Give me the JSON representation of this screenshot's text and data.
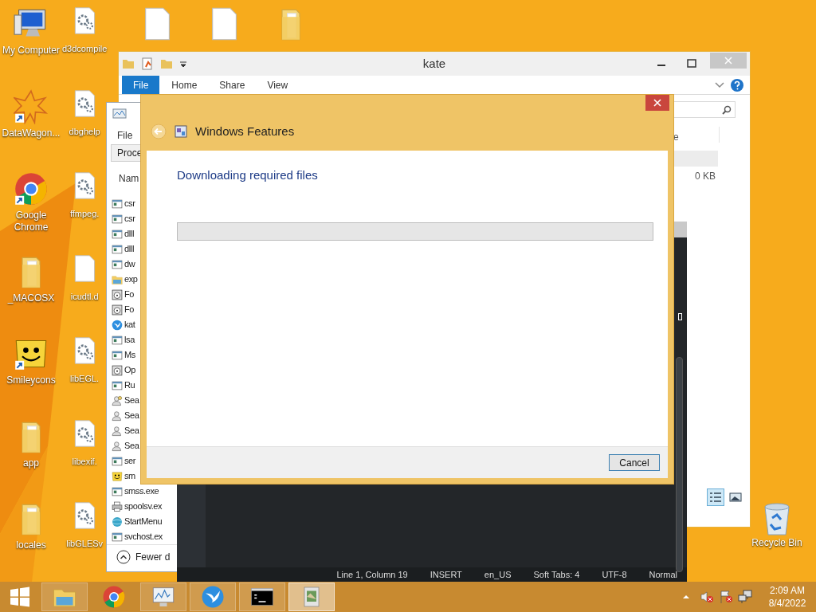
{
  "desktop_column_1": [
    {
      "label": "My Computer",
      "kind": "computer"
    },
    {
      "label": "DataWagon...",
      "kind": "star-shortcut"
    },
    {
      "label": "Google Chrome",
      "kind": "chrome-shortcut"
    },
    {
      "label": "_MACOSX",
      "kind": "folder"
    },
    {
      "label": "Smileycons",
      "kind": "smiley-shortcut"
    },
    {
      "label": "app",
      "kind": "folder"
    },
    {
      "label": "locales",
      "kind": "folder"
    }
  ],
  "desktop_column_2": [
    {
      "label": "d3dcompile",
      "kind": "gear-file"
    },
    {
      "label": "dbghelp",
      "kind": "gear-file"
    },
    {
      "label": "ffmpeg.",
      "kind": "gear-file"
    },
    {
      "label": "icudtl.d",
      "kind": "file"
    },
    {
      "label": "libEGL.",
      "kind": "gear-file"
    },
    {
      "label": "libexif.",
      "kind": "gear-file"
    },
    {
      "label": "libGLESv",
      "kind": "gear-file"
    }
  ],
  "explorer": {
    "title": "kate",
    "ribbon_tabs": [
      {
        "label": "File",
        "selected": true
      },
      {
        "label": "Home",
        "selected": false
      },
      {
        "label": "Share",
        "selected": false
      },
      {
        "label": "View",
        "selected": false
      }
    ],
    "column_header": "e",
    "size": "0 KB"
  },
  "task_manager": {
    "menu": "File",
    "tab": "Proce",
    "column": "Nam",
    "processes": [
      {
        "name": "csr",
        "kind": "exe"
      },
      {
        "name": "csr",
        "kind": "exe"
      },
      {
        "name": "dllI",
        "kind": "exe"
      },
      {
        "name": "dllI",
        "kind": "exe"
      },
      {
        "name": "dw",
        "kind": "exe"
      },
      {
        "name": "exp",
        "kind": "explorer"
      },
      {
        "name": "Fo",
        "kind": "disc"
      },
      {
        "name": "Fo",
        "kind": "disc"
      },
      {
        "name": "kat",
        "kind": "bird"
      },
      {
        "name": "lsa",
        "kind": "exe"
      },
      {
        "name": "Ms",
        "kind": "exe"
      },
      {
        "name": "Op",
        "kind": "disc"
      },
      {
        "name": "Ru",
        "kind": "exe"
      },
      {
        "name": "Sea",
        "kind": "user-search"
      },
      {
        "name": "Sea",
        "kind": "user"
      },
      {
        "name": "Sea",
        "kind": "user"
      },
      {
        "name": "Sea",
        "kind": "user"
      },
      {
        "name": "ser",
        "kind": "exe"
      },
      {
        "name": "sm",
        "kind": "smiley"
      },
      {
        "name": "smss.exe",
        "kind": "exe"
      },
      {
        "name": "spoolsv.ex",
        "kind": "printer"
      },
      {
        "name": "StartMenu",
        "kind": "globe"
      },
      {
        "name": "svchost.ex",
        "kind": "exe"
      }
    ],
    "footer": "Fewer d"
  },
  "kate": {
    "status_bar": [
      "Line 1, Column 19",
      "INSERT",
      "en_US",
      "Soft Tabs: 4",
      "UTF-8",
      "Normal"
    ]
  },
  "dialog": {
    "title": "Windows Features",
    "heading": "Downloading required files",
    "progress": {
      "level": 0
    },
    "buttons": [
      "Cancel"
    ]
  },
  "recycle_bin": "Recycle Bin",
  "taskbar": {
    "apps": [
      {
        "kind": "explorer",
        "running": true,
        "selected": false
      },
      {
        "kind": "chrome",
        "running": false,
        "selected": false
      },
      {
        "kind": "monitor",
        "running": true,
        "selected": false
      },
      {
        "kind": "bird",
        "running": true,
        "selected": false
      },
      {
        "kind": "console",
        "running": true,
        "selected": false
      },
      {
        "kind": "installer",
        "running": true,
        "selected": true
      }
    ],
    "time": "2:09 AM",
    "date": "8/4/2022"
  }
}
